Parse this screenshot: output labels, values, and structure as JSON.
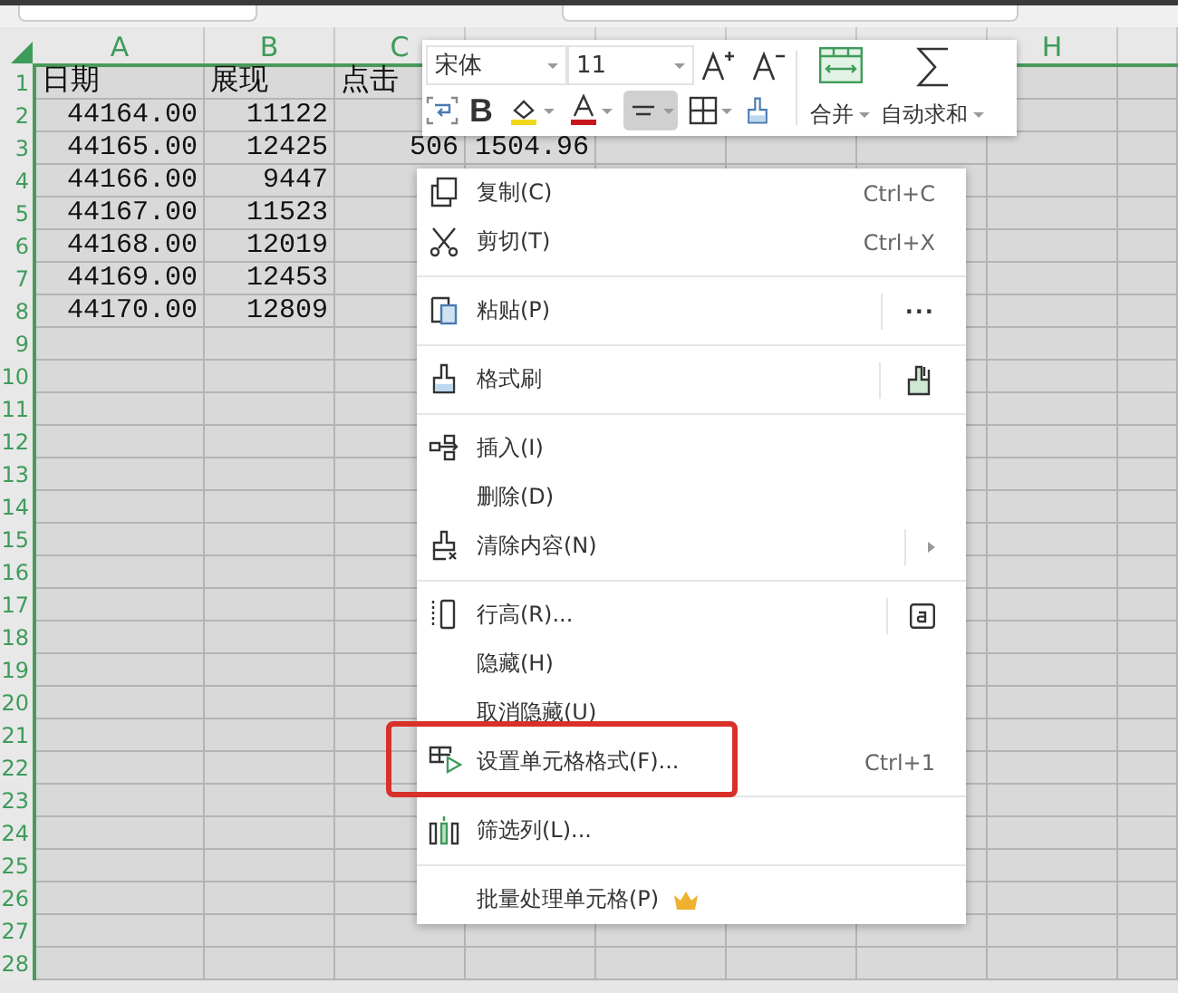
{
  "sheet": {
    "all_selected": true,
    "columns": [
      "A",
      "B",
      "C",
      null,
      null,
      null,
      null,
      "H",
      null
    ],
    "rows": [
      {
        "number": "1",
        "kind": "header",
        "cells": [
          "日期",
          "展现",
          "点击"
        ]
      },
      {
        "number": "2",
        "kind": "data",
        "cells": [
          "44164.00",
          "11122"
        ]
      },
      {
        "number": "3",
        "kind": "data",
        "cells": [
          "44165.00",
          "12425",
          "506",
          "1504.96"
        ]
      },
      {
        "number": "4",
        "kind": "data",
        "cells": [
          "44166.00",
          "9447"
        ]
      },
      {
        "number": "5",
        "kind": "data",
        "cells": [
          "44167.00",
          "11523"
        ]
      },
      {
        "number": "6",
        "kind": "data",
        "cells": [
          "44168.00",
          "12019"
        ]
      },
      {
        "number": "7",
        "kind": "data",
        "cells": [
          "44169.00",
          "12453"
        ]
      },
      {
        "number": "8",
        "kind": "data",
        "cells": [
          "44170.00",
          "12809"
        ]
      },
      {
        "number": "9"
      },
      {
        "number": "10"
      },
      {
        "number": "11"
      },
      {
        "number": "12"
      },
      {
        "number": "13"
      },
      {
        "number": "14"
      },
      {
        "number": "15"
      },
      {
        "number": "16"
      },
      {
        "number": "17"
      },
      {
        "number": "18"
      },
      {
        "number": "19"
      },
      {
        "number": "20"
      },
      {
        "number": "21"
      },
      {
        "number": "22"
      },
      {
        "number": "23"
      },
      {
        "number": "24"
      },
      {
        "number": "25"
      },
      {
        "number": "26"
      },
      {
        "number": "27"
      },
      {
        "number": "28"
      }
    ]
  },
  "toolbar": {
    "font": "宋体",
    "size": "11",
    "bold_glyph": "B",
    "align_pressed": true,
    "merge_label": "合并",
    "autosum_label": "自动求和"
  },
  "menu": {
    "items": [
      {
        "kind": "item",
        "label": "复制(C)",
        "shortcut": "Ctrl+C"
      },
      {
        "kind": "item",
        "label": "剪切(T)",
        "shortcut": "Ctrl+X"
      },
      {
        "kind": "separator"
      },
      {
        "kind": "item",
        "label": "粘贴(P)",
        "more": "···"
      },
      {
        "kind": "separator"
      },
      {
        "kind": "item",
        "label": "格式刷"
      },
      {
        "kind": "separator"
      },
      {
        "kind": "item",
        "label": "插入(I)"
      },
      {
        "kind": "item",
        "label": "删除(D)"
      },
      {
        "kind": "item",
        "label": "清除内容(N)"
      },
      {
        "kind": "separator"
      },
      {
        "kind": "item",
        "label": "行高(R)..."
      },
      {
        "kind": "item",
        "label": "隐藏(H)"
      },
      {
        "kind": "item",
        "label": "取消隐藏(U)"
      },
      {
        "kind": "item",
        "label": "设置单元格格式(F)...",
        "shortcut": "Ctrl+1",
        "annotated": true
      },
      {
        "kind": "separator"
      },
      {
        "kind": "item",
        "label": "筛选列(L)..."
      },
      {
        "kind": "separator"
      },
      {
        "kind": "item",
        "label": "批量处理单元格(P)"
      }
    ]
  }
}
